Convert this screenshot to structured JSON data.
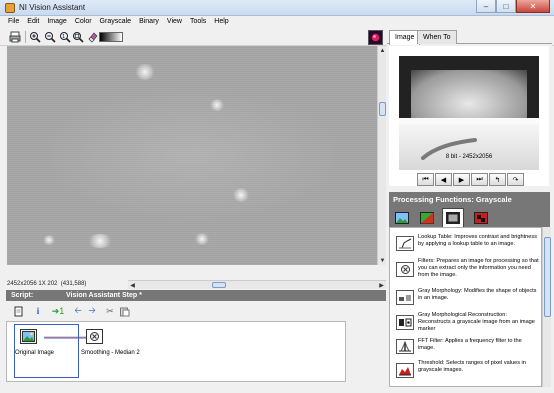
{
  "window": {
    "title": "NI Vision Assistant"
  },
  "menu": [
    "File",
    "Edit",
    "Image",
    "Color",
    "Grayscale",
    "Binary",
    "View",
    "Tools",
    "Help"
  ],
  "toolbar": {
    "icons": [
      "print-icon",
      "zoom-in-icon",
      "zoom-out-icon",
      "zoom-1to1-icon",
      "zoom-fit-icon",
      "erase-icon",
      "gradient-palette",
      "color-lut-icon"
    ]
  },
  "image_pane": {
    "status_size": "2452x2056 1X 202",
    "status_coord": "(431,588)"
  },
  "script_panel": {
    "title": "Script:",
    "step_title": "Vision Assistant Step *",
    "steps": [
      {
        "label": "Original Image"
      },
      {
        "label": "Smoothing - Median 2"
      }
    ]
  },
  "right_panel": {
    "tabs": [
      "Image",
      "When To"
    ],
    "image_info": "8 bit - 2452x2056",
    "processing_title": "Processing Functions: Grayscale",
    "functions": [
      {
        "title": "Lookup Table:",
        "desc": "Improves contrast and brightness by applying a lookup table to an image."
      },
      {
        "title": "Filters:",
        "desc": "Prepares an image for processing so that you can extract only the information you need from the image."
      },
      {
        "title": "Gray Morphology:",
        "desc": "Modifies the shape of objects in an image."
      },
      {
        "title": "Gray Morphological Reconstruction:",
        "desc": "Reconstructs a grayscale image from an image marker"
      },
      {
        "title": "FFT Filter:",
        "desc": "Applies a frequency filter to the image."
      },
      {
        "title": "Threshold:",
        "desc": "Selects ranges of pixel values in grayscale images."
      }
    ]
  },
  "colors": {
    "panel_header": "#777777",
    "selection_border": "#3b5fbf"
  }
}
